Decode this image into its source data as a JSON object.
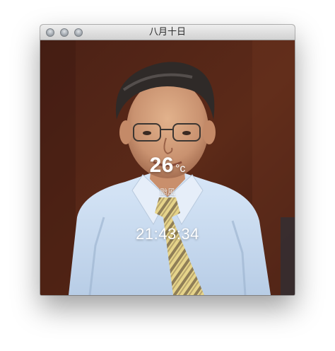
{
  "window": {
    "title": "八月十日"
  },
  "titlebar": {
    "buttons": [
      {
        "name": "close"
      },
      {
        "name": "minimize"
      },
      {
        "name": "zoom"
      }
    ]
  },
  "weather": {
    "temperature": "26",
    "unit": "°c",
    "condition": "颱風"
  },
  "clock": {
    "time": "21:43:34"
  },
  "colors": {
    "background_wall": "#5b2a18",
    "shirt": "#c8daf0",
    "overlay_text": "#ffffff"
  }
}
